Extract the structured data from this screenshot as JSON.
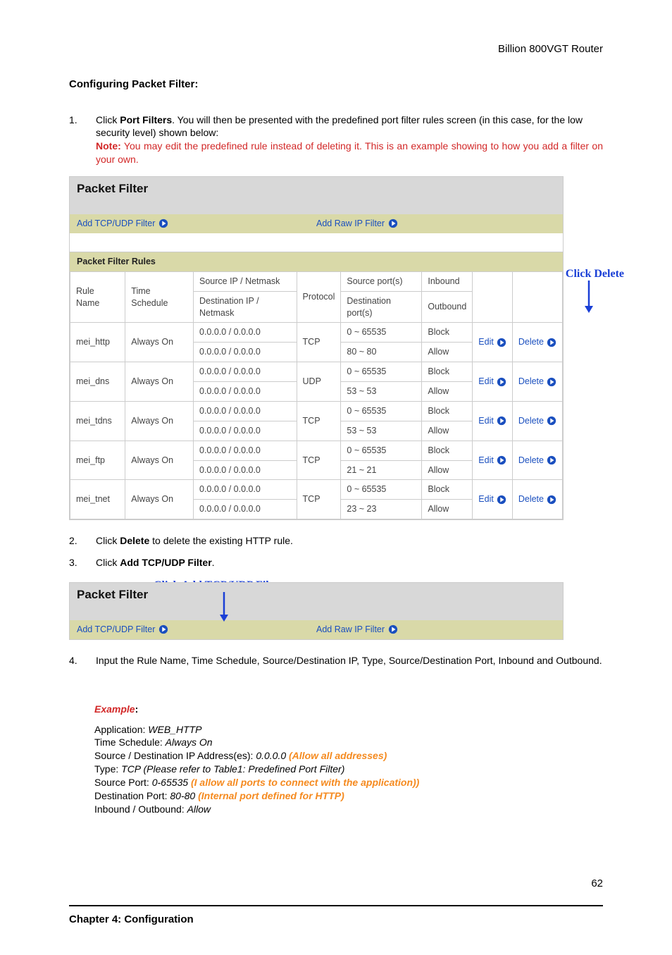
{
  "header": {
    "router_name": "Billion 800VGT Router"
  },
  "section": {
    "title": "Configuring Packet Filter:"
  },
  "step1": {
    "num": "1.",
    "pre": "Click ",
    "bold": "Port Filters",
    "post": ". You will then be presented with the predefined port filter rules screen (in this case, for the low security level) shown below:",
    "note_label": "Note:",
    "note_text": " You may edit the predefined rule instead of deleting it. This is an example showing to how you add a filter on your own."
  },
  "ui1": {
    "title": "Packet Filter",
    "link_tcp": "Add TCP/UDP Filter",
    "link_raw": "Add Raw IP Filter",
    "rules_title": "Packet Filter Rules",
    "hdr": {
      "rule": "Rule Name",
      "time": "Time Schedule",
      "src_ip": "Source IP / Netmask",
      "dst_ip": "Destination IP / Netmask",
      "proto": "Protocol",
      "srcp": "Source port(s)",
      "dstp": "Destination port(s)",
      "in": "Inbound",
      "out": "Outbound"
    },
    "edit": "Edit",
    "delete": "Delete",
    "rows": [
      {
        "name": "mei_http",
        "time": "Always On",
        "sip": "0.0.0.0 / 0.0.0.0",
        "dip": "0.0.0.0 / 0.0.0.0",
        "proto": "TCP",
        "sp": "0 ~ 65535",
        "dp": "80 ~ 80",
        "in": "Block",
        "out": "Allow"
      },
      {
        "name": "mei_dns",
        "time": "Always On",
        "sip": "0.0.0.0 / 0.0.0.0",
        "dip": "0.0.0.0 / 0.0.0.0",
        "proto": "UDP",
        "sp": "0 ~ 65535",
        "dp": "53 ~ 53",
        "in": "Block",
        "out": "Allow"
      },
      {
        "name": "mei_tdns",
        "time": "Always On",
        "sip": "0.0.0.0 / 0.0.0.0",
        "dip": "0.0.0.0 / 0.0.0.0",
        "proto": "TCP",
        "sp": "0 ~ 65535",
        "dp": "53 ~ 53",
        "in": "Block",
        "out": "Allow"
      },
      {
        "name": "mei_ftp",
        "time": "Always On",
        "sip": "0.0.0.0 / 0.0.0.0",
        "dip": "0.0.0.0 / 0.0.0.0",
        "proto": "TCP",
        "sp": "0 ~ 65535",
        "dp": "21 ~ 21",
        "in": "Block",
        "out": "Allow"
      },
      {
        "name": "mei_tnet",
        "time": "Always On",
        "sip": "0.0.0.0 / 0.0.0.0",
        "dip": "0.0.0.0 / 0.0.0.0",
        "proto": "TCP",
        "sp": "0 ~ 65535",
        "dp": "23 ~ 23",
        "in": "Block",
        "out": "Allow"
      }
    ],
    "callout_delete": "Click Delete"
  },
  "step2": {
    "num": "2.",
    "pre": "Click ",
    "bold": "Delete",
    "post": " to delete the existing HTTP rule."
  },
  "step3": {
    "num": "3.",
    "pre": "Click ",
    "bold": "Add TCP/UDP Filter",
    "post": "."
  },
  "ui2": {
    "callout": "Click Add TCP/UDP Filter",
    "title": "Packet Filter",
    "link_tcp": "Add TCP/UDP Filter",
    "link_raw": "Add Raw IP Filter"
  },
  "step4": {
    "num": "4.",
    "text": "Input the Rule Name, Time Schedule, Source/Destination IP, Type, Source/Destination Port, Inbound and Outbound."
  },
  "example": {
    "label": "Example",
    "colon": ":",
    "app_l": "Application: ",
    "app_v": "WEB_HTTP",
    "time_l": "Time Schedule: ",
    "time_v": "Always On",
    "ip_l": "Source / Destination IP Address(es): ",
    "ip_v": "0.0.0.0 ",
    "ip_note": "(Allow all addresses)",
    "type_l": "Type: ",
    "type_v": "TCP (Please refer to Table1: Predefined Port Filter)",
    "sp_l": "Source Port: ",
    "sp_v": "0-65535 ",
    "sp_note": "(I allow all ports to connect with the application))",
    "dp_l": "Destination Port: ",
    "dp_v": "80-80 ",
    "dp_note": "(Internal port defined for HTTP)",
    "io_l": "Inbound / Outbound: ",
    "io_v": "Allow"
  },
  "footer": {
    "chapter": "Chapter 4: Configuration",
    "page": "62"
  }
}
